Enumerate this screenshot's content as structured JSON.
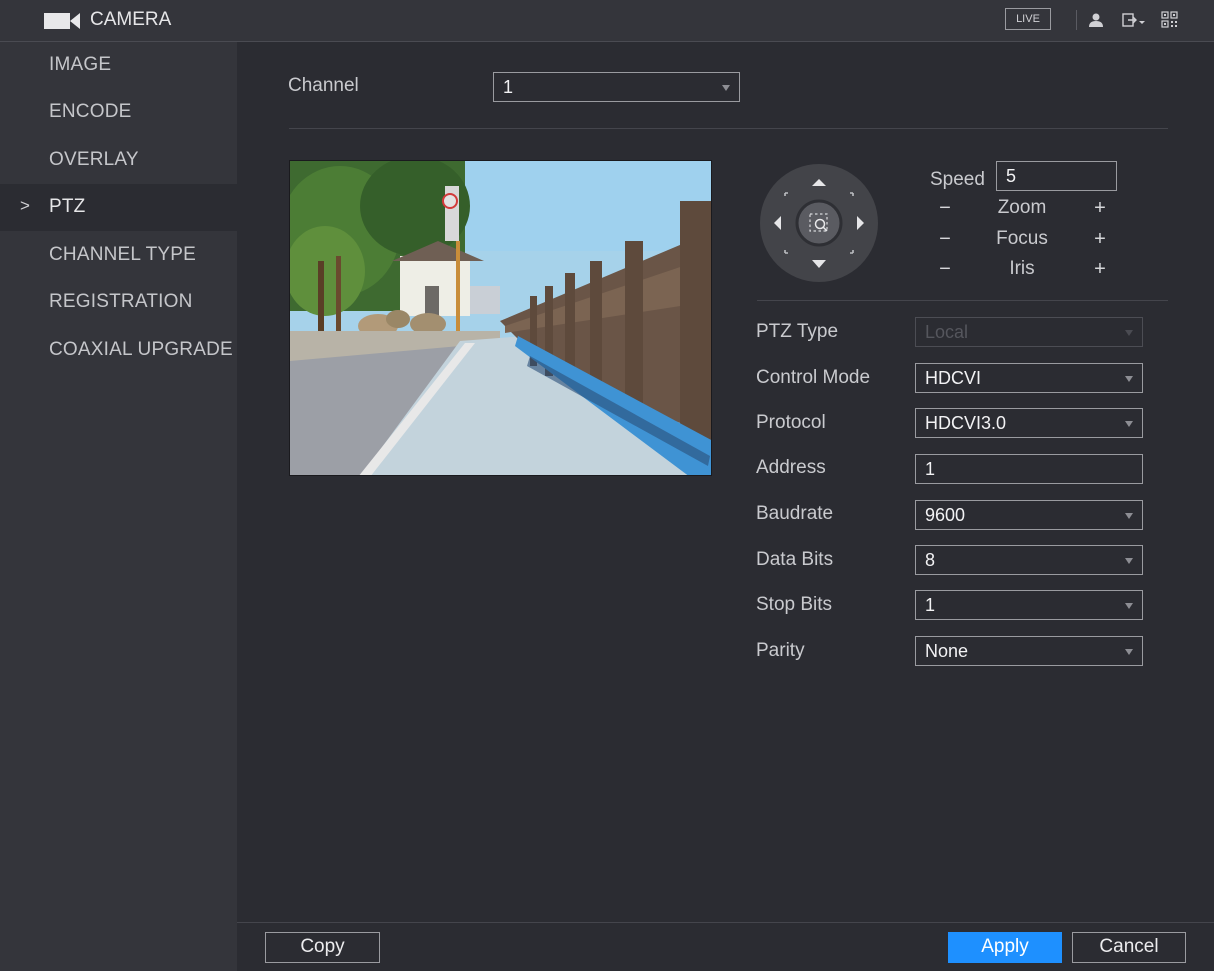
{
  "app": {
    "title": "CAMERA",
    "live_label": "LIVE"
  },
  "icons": {
    "camera": "video-camera-icon",
    "user": "user-icon",
    "logout": "logout-icon",
    "qr": "qr-code-icon",
    "chevron": "chevron-right-icon"
  },
  "sidebar": {
    "items": [
      {
        "label": "IMAGE",
        "active": false
      },
      {
        "label": "ENCODE",
        "active": false
      },
      {
        "label": "OVERLAY",
        "active": false
      },
      {
        "label": "PTZ",
        "active": true
      },
      {
        "label": "CHANNEL TYPE",
        "active": false
      },
      {
        "label": "REGISTRATION",
        "active": false
      },
      {
        "label": "COAXIAL UPGRADE",
        "active": false
      }
    ],
    "active_marker": ">"
  },
  "channel": {
    "label": "Channel",
    "value": "1"
  },
  "ptz_control": {
    "speed_label": "Speed",
    "speed_value": "5",
    "zoom_label": "Zoom",
    "focus_label": "Focus",
    "iris_label": "Iris",
    "minus": "−",
    "plus": "+"
  },
  "settings": {
    "ptz_type": {
      "label": "PTZ Type",
      "value": "Local",
      "disabled": true
    },
    "control_mode": {
      "label": "Control Mode",
      "value": "HDCVI"
    },
    "protocol": {
      "label": "Protocol",
      "value": "HDCVI3.0"
    },
    "address": {
      "label": "Address",
      "value": "1"
    },
    "baudrate": {
      "label": "Baudrate",
      "value": "9600"
    },
    "data_bits": {
      "label": "Data Bits",
      "value": "8"
    },
    "stop_bits": {
      "label": "Stop Bits",
      "value": "1"
    },
    "parity": {
      "label": "Parity",
      "value": "None"
    }
  },
  "footer": {
    "copy_label": "Copy",
    "apply_label": "Apply",
    "cancel_label": "Cancel"
  },
  "colors": {
    "accent": "#1e90ff",
    "background": "#2b2c32",
    "sidebar": "#34353b"
  }
}
